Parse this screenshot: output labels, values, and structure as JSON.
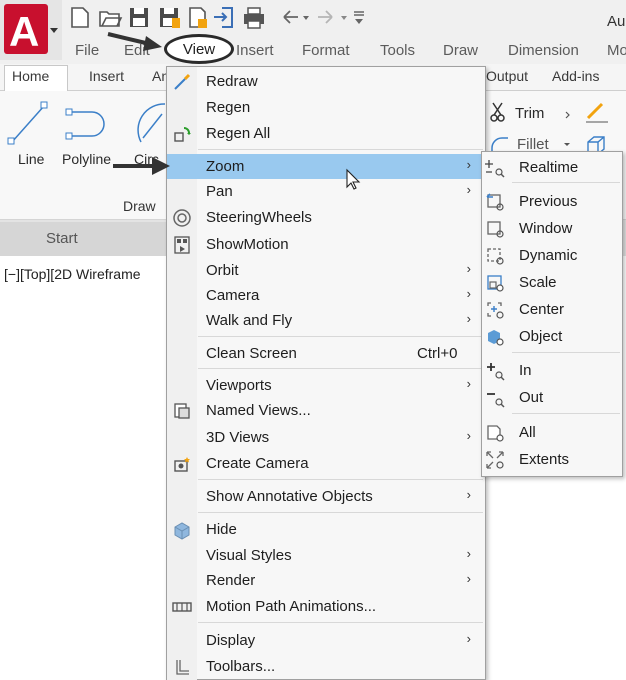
{
  "app": {
    "title_fragment": "Au",
    "accent": "#e5202e",
    "highlight": "#99c9ef"
  },
  "menubar": {
    "items": [
      "File",
      "Edit",
      "View",
      "Insert",
      "Format",
      "Tools",
      "Draw",
      "Dimension",
      "Mo"
    ]
  },
  "ribbon": {
    "tabs": [
      "Home",
      "Insert",
      "An",
      "Output",
      "Add-ins"
    ],
    "tools": {
      "line": "Line",
      "polyline": "Polyline",
      "circle": "Circ",
      "trim": "Trim",
      "fillet": "Fillet"
    },
    "panel_draw": "Draw"
  },
  "doc_tab": {
    "start": "Start"
  },
  "viewport_label": "[−][Top][2D Wireframe",
  "view_menu": {
    "items": [
      {
        "label": "Redraw",
        "icon": "redraw-icon"
      },
      {
        "label": "Regen"
      },
      {
        "label": "Regen All",
        "icon": "regen-all-icon"
      },
      {
        "label": "Zoom",
        "submenu": true,
        "highlighted": true
      },
      {
        "label": "Pan",
        "submenu": true
      },
      {
        "label": "SteeringWheels",
        "icon": "steering-wheel-icon"
      },
      {
        "label": "ShowMotion",
        "icon": "showmotion-icon"
      },
      {
        "label": "Orbit",
        "submenu": true
      },
      {
        "label": "Camera",
        "submenu": true
      },
      {
        "label": "Walk and Fly",
        "submenu": true
      },
      {
        "label": "Clean Screen",
        "shortcut": "Ctrl+0"
      },
      {
        "label": "Viewports",
        "submenu": true
      },
      {
        "label": "Named Views...",
        "icon": "named-views-icon"
      },
      {
        "label": "3D Views",
        "submenu": true
      },
      {
        "label": "Create Camera",
        "icon": "create-camera-icon"
      },
      {
        "label": "Show Annotative Objects",
        "submenu": true
      },
      {
        "label": "Hide",
        "icon": "hide-icon"
      },
      {
        "label": "Visual Styles",
        "submenu": true
      },
      {
        "label": "Render",
        "submenu": true
      },
      {
        "label": "Motion Path Animations...",
        "icon": "motion-path-icon"
      },
      {
        "label": "Display",
        "submenu": true
      },
      {
        "label": "Toolbars...",
        "icon": "toolbars-icon"
      }
    ],
    "submenu_arrow": "›"
  },
  "zoom_submenu": {
    "items": [
      {
        "label": "Realtime",
        "icon": "zoom-realtime-icon"
      },
      {
        "label": "Previous",
        "icon": "zoom-previous-icon"
      },
      {
        "label": "Window",
        "icon": "zoom-window-icon"
      },
      {
        "label": "Dynamic",
        "icon": "zoom-dynamic-icon"
      },
      {
        "label": "Scale",
        "icon": "zoom-scale-icon"
      },
      {
        "label": "Center",
        "icon": "zoom-center-icon"
      },
      {
        "label": "Object",
        "icon": "zoom-object-icon"
      },
      {
        "label": "In",
        "icon": "zoom-in-icon"
      },
      {
        "label": "Out",
        "icon": "zoom-out-icon"
      },
      {
        "label": "All",
        "icon": "zoom-all-icon"
      },
      {
        "label": "Extents",
        "icon": "zoom-extents-icon"
      }
    ]
  }
}
